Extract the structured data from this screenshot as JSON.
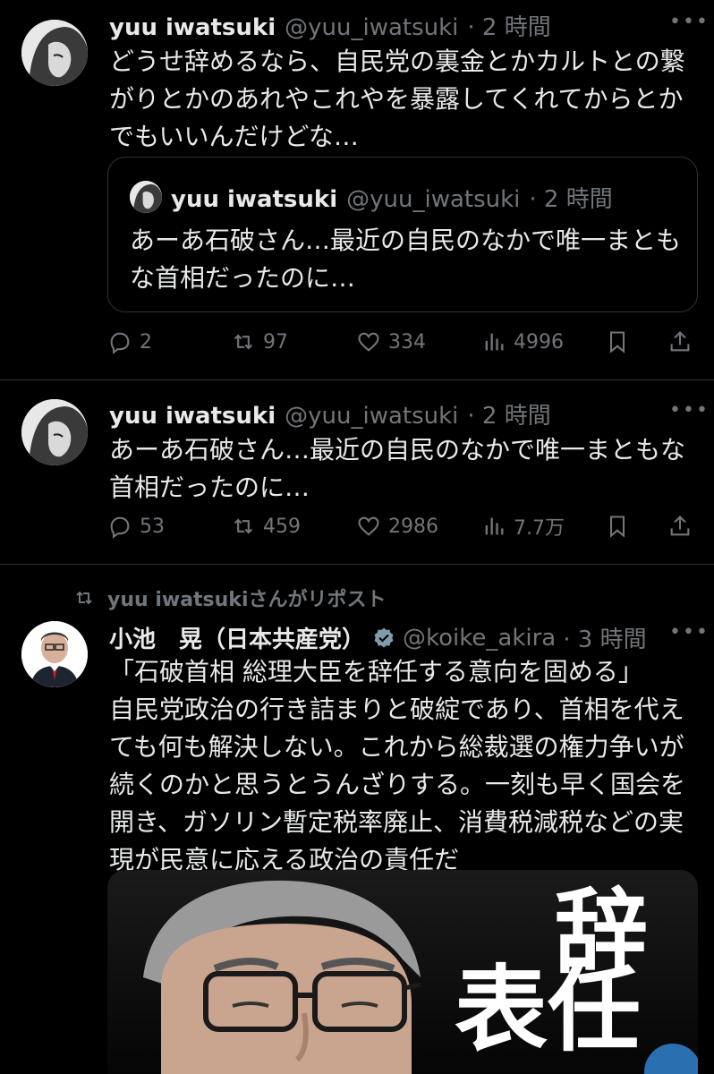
{
  "tweet1": {
    "name": "yuu iwatsuki",
    "handle": "@yuu_iwatsuki",
    "time": "· 2 時間",
    "line1": "どうせ辞めるなら、自民党の裏金とかカルトとの繋",
    "line2": "がりとかのあれやこれやを暴露してくれてからとか",
    "line3": "でもいいんだけどな…",
    "quote": {
      "name": "yuu iwatsuki",
      "handle": "@yuu_iwatsuki",
      "time": "· 2 時間",
      "line1": "あーあ石破さん…最近の自民のなかで唯一まとも",
      "line2": "な首相だったのに…"
    },
    "replies": "2",
    "reposts": "97",
    "likes": "334",
    "views": "4996"
  },
  "tweet2": {
    "name": "yuu iwatsuki",
    "handle": "@yuu_iwatsuki",
    "time": "· 2 時間",
    "line1": "あーあ石破さん…最近の自民のなかで唯一まともな",
    "line2": "首相だったのに…",
    "replies": "53",
    "reposts": "459",
    "likes": "2986",
    "views": "7.7万"
  },
  "tweet3": {
    "repost_label": "yuu iwatsukiさんがリポスト",
    "name": "小池　晃（日本共産党）",
    "handle": "@koike_akira",
    "time": "· 3 時間",
    "line1": "「石破首相 総理大臣を辞任する意向を固める」",
    "line2": "自民党政治の行き詰まりと破綻であり、首相を代え",
    "line3": "ても何も解決しない。これから総裁選の権力争いが",
    "line4": "続くのかと思うとうんざりする。一刻も早く国会を",
    "line5": "開き、ガソリン暫定税率廃止、消費税減税などの実",
    "line6": "現が民意に応える政治の責任だ",
    "image_text1": "辞",
    "image_text2": "表任"
  },
  "icons": {
    "reply": "reply-icon",
    "repost": "repost-icon",
    "like": "heart-icon",
    "views": "views-icon",
    "bookmark": "bookmark-icon",
    "share": "share-icon",
    "verified": "verified-badge-icon"
  },
  "colors": {
    "background": "#000000",
    "text": "#e7e9ea",
    "secondary": "#71767b",
    "verified": "#829aab",
    "accent": "#1d9bf0"
  }
}
